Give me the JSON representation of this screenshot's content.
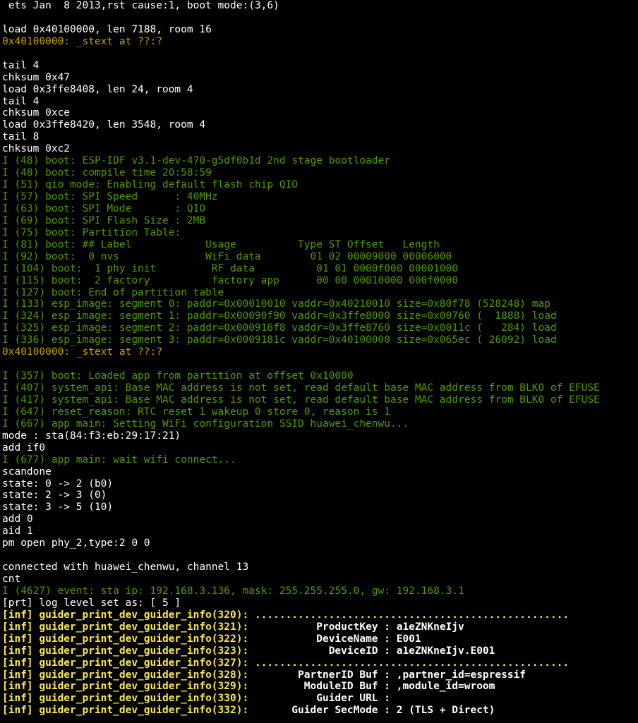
{
  "terminal": {
    "lines": [
      {
        "text": " ets Jan  8 2013,rst cause:1, boot mode:(3,6)",
        "color": "white"
      },
      {
        "text": "",
        "color": "white"
      },
      {
        "text": "load 0x40100000, len 7188, room 16",
        "color": "white"
      },
      {
        "text": "0x40100000: _stext at ??:?",
        "color": "yellow"
      },
      {
        "text": "",
        "color": "white"
      },
      {
        "text": "tail 4",
        "color": "white"
      },
      {
        "text": "chksum 0x47",
        "color": "white"
      },
      {
        "text": "load 0x3ffe8408, len 24, room 4",
        "color": "white"
      },
      {
        "text": "tail 4",
        "color": "white"
      },
      {
        "text": "chksum 0xce",
        "color": "white"
      },
      {
        "text": "load 0x3ffe8420, len 3548, room 4",
        "color": "white"
      },
      {
        "text": "tail 8",
        "color": "white"
      },
      {
        "text": "chksum 0xc2",
        "color": "white"
      },
      {
        "text": "I (48) boot: ESP-IDF v3.1-dev-470-g5df0b1d 2nd stage bootloader",
        "color": "green"
      },
      {
        "text": "I (48) boot: compile time 20:58:59",
        "color": "green"
      },
      {
        "text": "I (51) qio_mode: Enabling default flash chip QIO",
        "color": "green"
      },
      {
        "text": "I (57) boot: SPI Speed      : 40MHz",
        "color": "green"
      },
      {
        "text": "I (63) boot: SPI Mode       : QIO",
        "color": "green"
      },
      {
        "text": "I (69) boot: SPI Flash Size : 2MB",
        "color": "green"
      },
      {
        "text": "I (75) boot: Partition Table:",
        "color": "green"
      },
      {
        "text": "I (81) boot: ## Label            Usage          Type ST Offset   Length",
        "color": "green"
      },
      {
        "text": "I (92) boot:  0 nvs              WiFi data        01 02 00009000 00006000",
        "color": "green"
      },
      {
        "text": "I (104) boot:  1 phy_init         RF data          01 01 0000f000 00001000",
        "color": "green"
      },
      {
        "text": "I (115) boot:  2 factory          factory app      00 00 00010000 000f0000",
        "color": "green"
      },
      {
        "text": "I (127) boot: End of partition table",
        "color": "green"
      },
      {
        "text": "I (133) esp_image: segment 0: paddr=0x00010010 vaddr=0x40210010 size=0x80f78 (528248) map",
        "color": "green"
      },
      {
        "text": "I (324) esp_image: segment 1: paddr=0x00090f90 vaddr=0x3ffe8000 size=0x00760 (  1888) load",
        "color": "green"
      },
      {
        "text": "I (325) esp_image: segment 2: paddr=0x000916f8 vaddr=0x3ffe8760 size=0x0011c (   284) load",
        "color": "green"
      },
      {
        "text": "I (336) esp_image: segment 3: paddr=0x0009181c vaddr=0x40100000 size=0x065ec ( 26092) load",
        "color": "green"
      },
      {
        "text": "0x40100000: _stext at ??:?",
        "color": "yellow"
      },
      {
        "text": "",
        "color": "white"
      },
      {
        "text": "I (357) boot: Loaded app from partition at offset 0x10000",
        "color": "green"
      },
      {
        "text": "I (407) system_api: Base MAC address is not set, read default base MAC address from BLK0 of EFUSE",
        "color": "green"
      },
      {
        "text": "I (417) system_api: Base MAC address is not set, read default base MAC address from BLK0 of EFUSE",
        "color": "green"
      },
      {
        "text": "I (647) reset_reason: RTC reset 1 wakeup 0 store 0, reason is 1",
        "color": "green"
      },
      {
        "text": "I (667) app main: Setting WiFi configuration SSID huawei_chenwu...",
        "color": "green"
      },
      {
        "text": "mode : sta(84:f3:eb:29:17:21)",
        "color": "white"
      },
      {
        "text": "add if0",
        "color": "white"
      },
      {
        "text": "I (677) app main: wait wifi connect...",
        "color": "green"
      },
      {
        "text": "scandone",
        "color": "white"
      },
      {
        "text": "state: 0 -> 2 (b0)",
        "color": "white"
      },
      {
        "text": "state: 2 -> 3 (0)",
        "color": "white"
      },
      {
        "text": "state: 3 -> 5 (10)",
        "color": "white"
      },
      {
        "text": "add 0",
        "color": "white"
      },
      {
        "text": "aid 1",
        "color": "white"
      },
      {
        "text": "pm open phy_2,type:2 0 0",
        "color": "white"
      },
      {
        "text": "",
        "color": "white"
      },
      {
        "text": "connected with huawei_chenwu, channel 13",
        "color": "white"
      },
      {
        "text": "cnt",
        "color": "white"
      },
      {
        "text": "I (4627) event: sta ip: 192.168.3.136, mask: 255.255.255.0, gw: 192.168.3.1",
        "color": "green"
      },
      {
        "text": "[prt] log level set as: [ 5 ]",
        "color": "white"
      },
      {
        "text": "[inf] guider_print_dev_guider_info(320): ...................................................",
        "color": "bold-yellow"
      },
      {
        "text": "[inf] guider_print_dev_guider_info(321):",
        "color": "bold-yellow",
        "suffix": "           ProductKey : a1eZNKneIjv"
      },
      {
        "text": "[inf] guider_print_dev_guider_info(322):",
        "color": "bold-yellow",
        "suffix": "           DeviceName : E001"
      },
      {
        "text": "[inf] guider_print_dev_guider_info(323):",
        "color": "bold-yellow",
        "suffix": "             DeviceID : a1eZNKneIjv.E001"
      },
      {
        "text": "[inf] guider_print_dev_guider_info(327): ...................................................",
        "color": "bold-yellow"
      },
      {
        "text": "[inf] guider_print_dev_guider_info(328):",
        "color": "bold-yellow",
        "suffix": "        PartnerID Buf : ,partner_id=espressif"
      },
      {
        "text": "[inf] guider_print_dev_guider_info(329):",
        "color": "bold-yellow",
        "suffix": "         ModuleID Buf : ,module_id=wroom"
      },
      {
        "text": "[inf] guider_print_dev_guider_info(330):",
        "color": "bold-yellow",
        "suffix": "           Guider URL :"
      },
      {
        "text": "[inf] guider_print_dev_guider_info(332):",
        "color": "bold-yellow",
        "suffix": "       Guider SecMode : 2 (TLS + Direct)"
      }
    ]
  }
}
